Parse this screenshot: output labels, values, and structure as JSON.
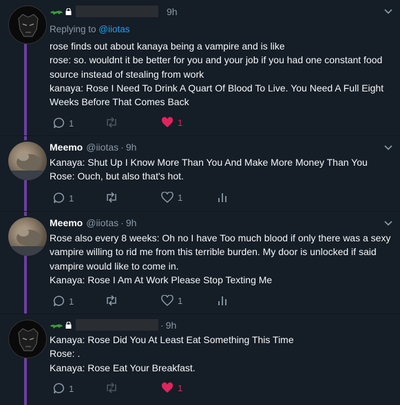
{
  "tweets": [
    {
      "name": "",
      "handle": "",
      "time": "9h",
      "replying_prefix": "Replying to ",
      "replying_to": "@iiotas",
      "lines": [
        "rose finds out about kanaya being a vampire and is like",
        "rose: so. wouldnt it be better for you and your job if you had one constant food",
        "source instead of stealing from work",
        "kanaya: Rose I Need To Drink A Quart Of Blood To Live. You Need A Full Eight",
        "Weeks Before That Comes Back"
      ],
      "reply_count": "1",
      "retweet_count": "",
      "like_count": "1",
      "liked": true
    },
    {
      "name": "Meemo",
      "handle": "@iiotas",
      "time": "9h",
      "lines": [
        "Kanaya: Shut Up I Know More Than You And Make More Money Than You",
        "Rose: Ouch, but also that's hot."
      ],
      "reply_count": "1",
      "retweet_count": "",
      "like_count": "1",
      "liked": false
    },
    {
      "name": "Meemo",
      "handle": "@iiotas",
      "time": "9h",
      "lines": [
        "Rose also every 8 weeks: Oh no I have Too much blood if only there was a sexy",
        "vampire willing to rid me from this terrible burden. My door is unlocked if said",
        "vampire would like to come in.",
        "Kanaya: Rose I Am At Work Please Stop Texting Me"
      ],
      "reply_count": "1",
      "retweet_count": "",
      "like_count": "1",
      "liked": false
    },
    {
      "name": "",
      "handle": "",
      "time": "9h",
      "lines": [
        "Kanaya: Rose Did You At Least Eat Something This Time",
        "Rose: .",
        "Kanaya: Rose Eat Your Breakfast."
      ],
      "reply_count": "1",
      "retweet_count": "",
      "like_count": "1",
      "liked": true
    }
  ],
  "colors": {
    "background": "#151d26",
    "text": "#f5f8fa",
    "muted": "#8899a6",
    "mention": "#1da1f2",
    "like": "#e0245e",
    "thread": "#6b3fa0",
    "lizard": "#3a9e3a"
  },
  "icons": [
    "lizard-icon",
    "lock-icon",
    "chevron-down-icon",
    "reply-icon",
    "retweet-icon",
    "heart-icon",
    "analytics-icon"
  ]
}
